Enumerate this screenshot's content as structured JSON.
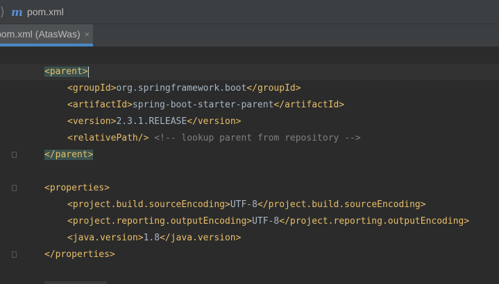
{
  "breadcrumb": {
    "file": "pom.xml"
  },
  "tab": {
    "label": "pom.xml (AtasWas)",
    "close": "×"
  },
  "code": {
    "parent_open": "<parent>",
    "groupId_open": "<groupId>",
    "groupId_val": "org.springframework.boot",
    "groupId_close": "</groupId>",
    "artifactId_open": "<artifactId>",
    "artifactId_val": "spring-boot-starter-parent",
    "artifactId_close": "</artifactId>",
    "version_open": "<version>",
    "version_val": "2.3.1.RELEASE",
    "version_close": "</version>",
    "relativePath": "<relativePath/>",
    "comment": "<!-- lookup parent from repository -->",
    "parent_close": "</parent>",
    "properties_open": "<properties>",
    "src_enc_open": "<project.build.sourceEncoding>",
    "src_enc_val": "UTF-8",
    "src_enc_close": "</project.build.sourceEncoding>",
    "out_enc_open": "<project.reporting.outputEncoding>",
    "out_enc_val": "UTF-8",
    "out_enc_close": "</project.reporting.outputEncoding>",
    "java_open": "<java.version>",
    "java_val": "1.8",
    "java_close": "</java.version>",
    "properties_close": "</properties>"
  }
}
